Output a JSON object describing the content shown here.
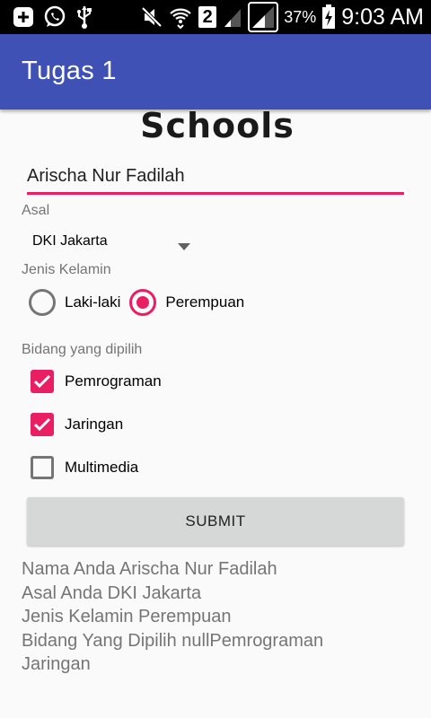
{
  "status_bar": {
    "battery_percent": "37%",
    "sim_slot": "2",
    "time": "9:03 AM"
  },
  "app_bar": {
    "title": "Tugas 1"
  },
  "form": {
    "logo_title": "Schools",
    "name_value": "Arischa Nur Fadilah",
    "asal": {
      "label": "Asal",
      "selected": "DKI Jakarta"
    },
    "gender": {
      "label": "Jenis Kelamin",
      "options": [
        {
          "label": "Laki-laki",
          "checked": false
        },
        {
          "label": "Perempuan",
          "checked": true
        }
      ]
    },
    "bidang": {
      "label": "Bidang yang dipilih",
      "options": [
        {
          "label": "Pemrograman",
          "checked": true
        },
        {
          "label": "Jaringan",
          "checked": true
        },
        {
          "label": "Multimedia",
          "checked": false
        }
      ]
    },
    "submit_label": "SUBMIT"
  },
  "result": {
    "lines": [
      "Nama Anda Arischa Nur Fadilah",
      "Asal Anda DKI Jakarta",
      "Jenis Kelamin Perempuan",
      "Bidang Yang Dipilih nullPemrograman",
      "Jaringan"
    ]
  },
  "colors": {
    "primary": "#3f51b5",
    "accent": "#e91e63",
    "status_bar": "#000000"
  },
  "icons": {
    "status_left": [
      "plus-box-icon",
      "whatsapp-icon",
      "usb-icon"
    ],
    "status_right": [
      "mute-icon",
      "wifi-icon",
      "sim2-icon",
      "signal-weak-icon",
      "signal-icon",
      "battery-charging-icon"
    ]
  }
}
